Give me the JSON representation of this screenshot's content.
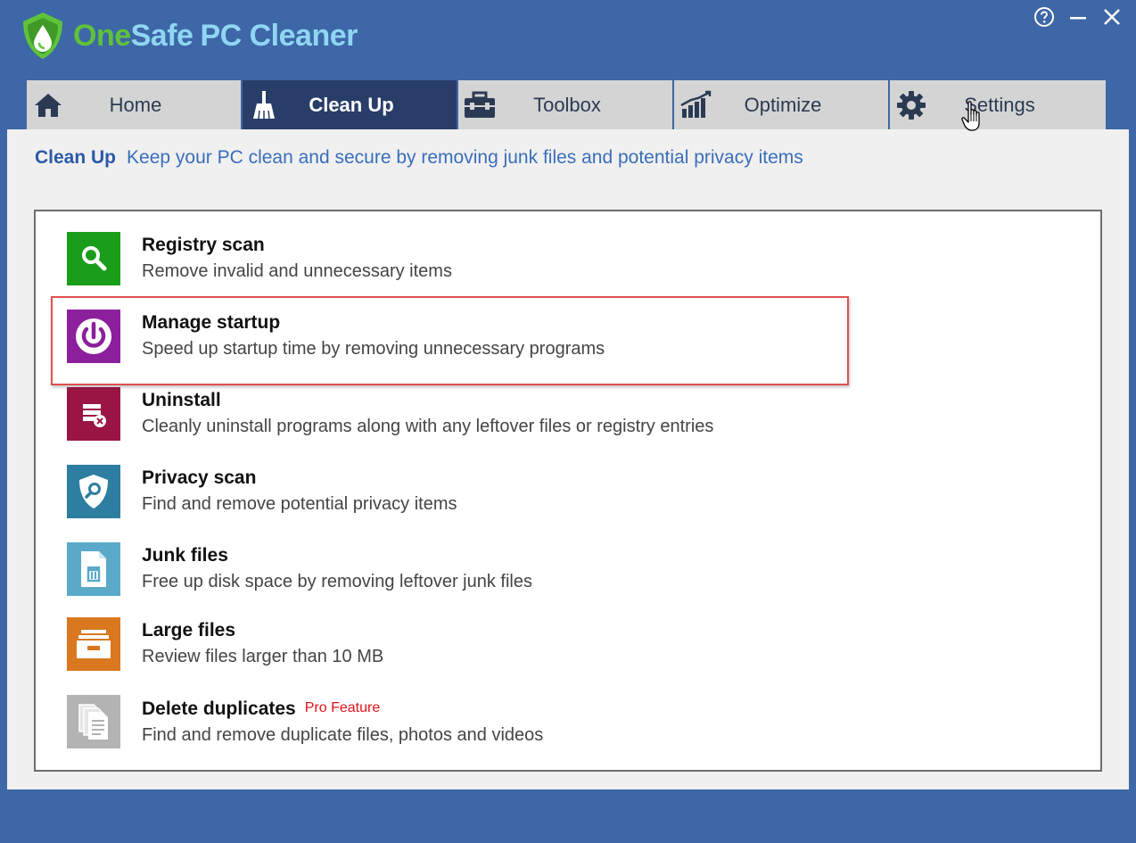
{
  "app": {
    "title_part1": "One",
    "title_part2": "Safe",
    "title_part3": "PC Cleaner",
    "colors": {
      "frame": "#3d67a6",
      "tab_active": "#293d69",
      "tab_inactive": "#d4d4d4",
      "accent_title": "#2a5aa7"
    }
  },
  "window_controls": {
    "help_icon": "question-circle-icon",
    "minimize_icon": "minimize-icon",
    "close_icon": "close-icon"
  },
  "tabs": [
    {
      "label": "Home",
      "icon": "home-icon",
      "active": false
    },
    {
      "label": "Clean Up",
      "icon": "broom-icon",
      "active": true
    },
    {
      "label": "Toolbox",
      "icon": "toolbox-icon",
      "active": false
    },
    {
      "label": "Optimize",
      "icon": "chart-bars-icon",
      "active": false
    },
    {
      "label": "Settings",
      "icon": "gear-icon",
      "active": false
    }
  ],
  "page": {
    "title": "Clean Up",
    "description": "Keep your PC clean and secure by removing junk files and potential privacy items"
  },
  "items": [
    {
      "title": "Registry scan",
      "description": "Remove invalid and unnecessary items",
      "icon": "magnifier-icon",
      "color": "#1a9e1a"
    },
    {
      "title": "Manage startup",
      "description": "Speed up startup time by removing unnecessary programs",
      "icon": "power-icon",
      "color": "#8b1f9c"
    },
    {
      "title": "Uninstall",
      "description": "Cleanly uninstall programs along with any leftover files or registry entries",
      "icon": "uninstall-icon",
      "color": "#9a1545"
    },
    {
      "title": "Privacy scan",
      "description": "Find and remove potential privacy items",
      "icon": "shield-search-icon",
      "color": "#2d7ea0"
    },
    {
      "title": "Junk files",
      "description": "Free up disk space by removing leftover junk files",
      "icon": "trash-file-icon",
      "color": "#5aa9c9"
    },
    {
      "title": "Large files",
      "description": "Review files larger than 10 MB",
      "icon": "cabinet-icon",
      "color": "#d9781f"
    },
    {
      "title": "Delete duplicates",
      "description": "Find and remove duplicate files, photos and videos",
      "icon": "duplicate-files-icon",
      "color": "#aaaaaa",
      "badge": "Pro Feature"
    }
  ]
}
